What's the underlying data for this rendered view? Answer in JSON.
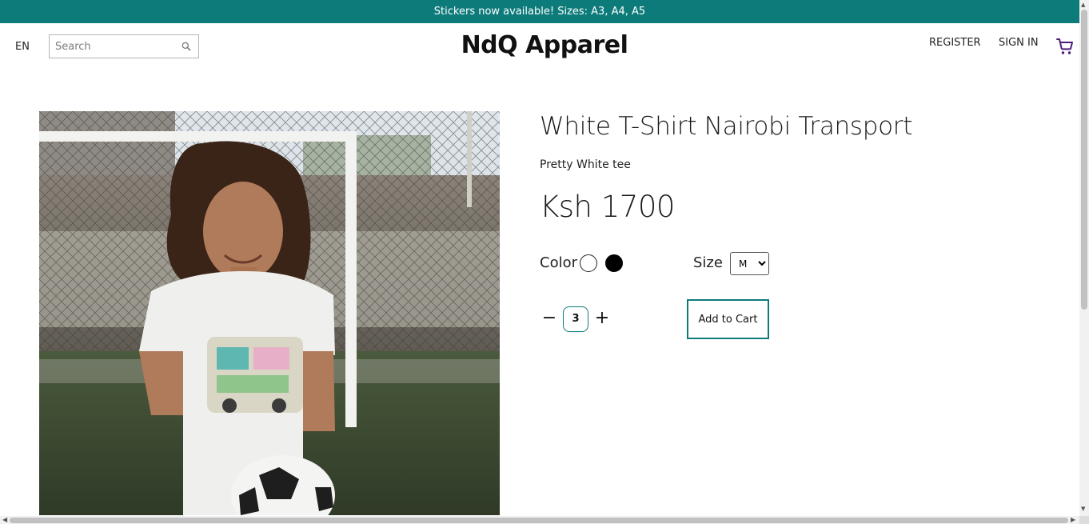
{
  "announcement": "Stickers now available! Sizes: A3, A4, A5",
  "header": {
    "language": "EN",
    "search_placeholder": "Search",
    "brand": "NdQ Apparel",
    "register": "REGISTER",
    "sign_in": "SIGN IN"
  },
  "product": {
    "title": "White T-Shirt Nairobi Transport",
    "subtitle": "Pretty White tee",
    "price": "Ksh 1700",
    "color_label": "Color",
    "colors": [
      "white",
      "black"
    ],
    "size_label": "Size",
    "size_options": [
      "M"
    ],
    "size_selected": "M",
    "quantity": "3",
    "qty_minus": "−",
    "qty_plus": "+",
    "add_to_cart": "Add to Cart"
  },
  "theme": {
    "accent": "#0e7b7b",
    "cart_icon_color": "#4a1f7a"
  }
}
